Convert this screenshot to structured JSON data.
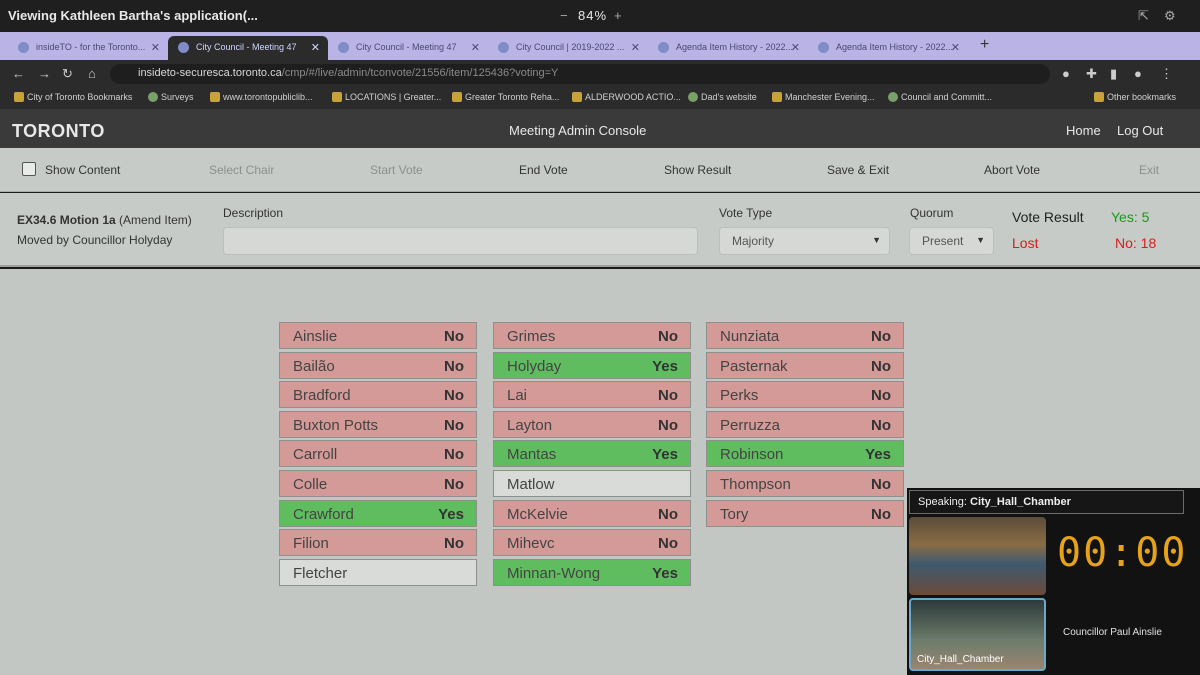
{
  "sharebar": {
    "title": "Viewing Kathleen Bartha's application(...",
    "zoom": "84%",
    "minus": "−",
    "plus": "+"
  },
  "tabs": [
    {
      "label": "insideTO - for the Toronto..."
    },
    {
      "label": "City Council - Meeting 47"
    },
    {
      "label": "City Council - Meeting 47"
    },
    {
      "label": "City Council | 2019-2022 ..."
    },
    {
      "label": "Agenda Item History - 2022..."
    },
    {
      "label": "Agenda Item History - 2022..."
    }
  ],
  "address": {
    "host": "insideto-securesca.toronto.ca",
    "path": "/cmp/#/live/admin/tconvote/21556/item/125436?voting=Y"
  },
  "bookmarks": [
    "City of Toronto Bookmarks",
    "Surveys",
    "www.torontopubliclib...",
    "LOCATIONS | Greater...",
    "Greater Toronto Reha...",
    "ALDERWOOD ACTIO...",
    "Dad's website",
    "Manchester Evening...",
    "Council and Committ...",
    "Other bookmarks"
  ],
  "header": {
    "logo": "TORONTO",
    "title": "Meeting Admin Console",
    "home": "Home",
    "logout": "Log Out"
  },
  "toolbar": {
    "show_content": "Show Content",
    "select_chair": "Select Chair",
    "start_vote": "Start Vote",
    "end_vote": "End Vote",
    "show_result": "Show Result",
    "save_exit": "Save & Exit",
    "abort_vote": "Abort Vote",
    "exit": "Exit"
  },
  "motion": {
    "id": "EX34.6 Motion 1a",
    "type": "(Amend Item)",
    "moved_by": "Moved by Councillor Holyday",
    "description_label": "Description",
    "description_value": "",
    "vote_type_label": "Vote Type",
    "vote_type_value": "Majority",
    "quorum_label": "Quorum",
    "quorum_value": "Present",
    "result_label": "Vote Result",
    "result_value": "Lost",
    "yes_count": "Yes: 5",
    "no_count": "No: 18"
  },
  "colors": {
    "yes": "#5fbd5f",
    "no": "#d49a98",
    "absent": "#d8dbd8",
    "yes_text": "#1a9a1a",
    "no_text": "#d41e1e"
  },
  "votes": [
    [
      {
        "name": "Ainslie",
        "vote": "No"
      },
      {
        "name": "Bailão",
        "vote": "No"
      },
      {
        "name": "Bradford",
        "vote": "No"
      },
      {
        "name": "Buxton Potts",
        "vote": "No"
      },
      {
        "name": "Carroll",
        "vote": "No"
      },
      {
        "name": "Colle",
        "vote": "No"
      },
      {
        "name": "Crawford",
        "vote": "Yes"
      },
      {
        "name": "Filion",
        "vote": "No"
      },
      {
        "name": "Fletcher",
        "vote": ""
      }
    ],
    [
      {
        "name": "Grimes",
        "vote": "No"
      },
      {
        "name": "Holyday",
        "vote": "Yes"
      },
      {
        "name": "Lai",
        "vote": "No"
      },
      {
        "name": "Layton",
        "vote": "No"
      },
      {
        "name": "Mantas",
        "vote": "Yes"
      },
      {
        "name": "Matlow",
        "vote": ""
      },
      {
        "name": "McKelvie",
        "vote": "No"
      },
      {
        "name": "Mihevc",
        "vote": "No"
      },
      {
        "name": "Minnan-Wong",
        "vote": "Yes"
      }
    ],
    [
      {
        "name": "Nunziata",
        "vote": "No"
      },
      {
        "name": "Pasternak",
        "vote": "No"
      },
      {
        "name": "Perks",
        "vote": "No"
      },
      {
        "name": "Perruzza",
        "vote": "No"
      },
      {
        "name": "Robinson",
        "vote": "Yes"
      },
      {
        "name": "Thompson",
        "vote": "No"
      },
      {
        "name": "Tory",
        "vote": "No"
      }
    ]
  ],
  "video": {
    "speaking_label": "Speaking:",
    "speaking_value": "City_Hall_Chamber",
    "clock": "00:00",
    "chamber_label": "City_Hall_Chamber",
    "person": "Councillor Paul Ainslie"
  }
}
